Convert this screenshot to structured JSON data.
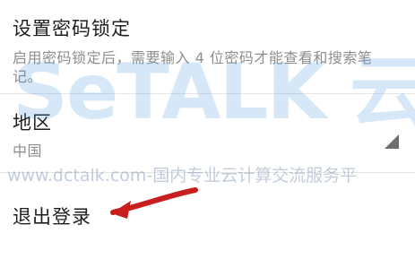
{
  "settings": {
    "password_lock": {
      "title": "设置密码锁定",
      "description": "启用密码锁定后，需要输入 4 位密码才能查看和搜索笔记。"
    },
    "region": {
      "title": "地区",
      "value": "中国"
    },
    "logout": {
      "title": "退出登录"
    }
  },
  "watermark": {
    "logo_text": "SeTALK 云试",
    "site_text": "www.dctalk.com-国内专业云计算交流服务平"
  },
  "icons": {
    "region_corner": "dropdown-corner-icon",
    "annotation": "red-arrow-icon"
  },
  "colors": {
    "arrow": "#c81e1e",
    "text_primary": "#1f1f1f",
    "text_secondary": "#8e8e8e"
  }
}
